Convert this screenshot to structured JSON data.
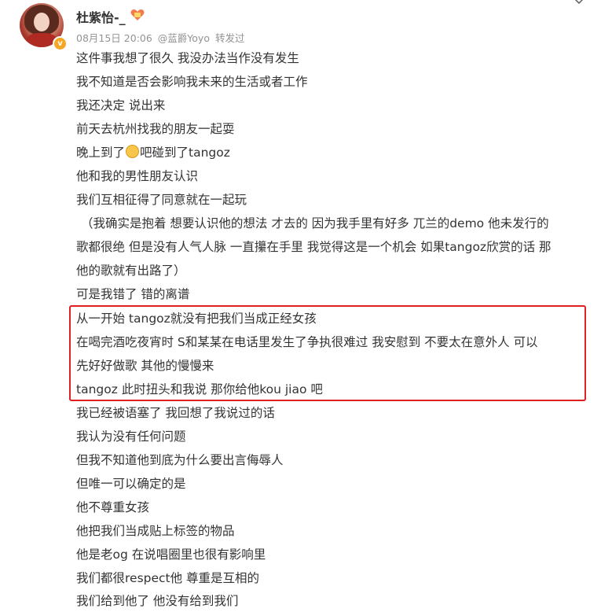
{
  "post": {
    "author": "杜紫怡-_",
    "date": "08月15日 20:06",
    "via_user": "@蓝爵Yoyo",
    "via_action": "转发过",
    "lines": [
      "这件事我想了很久 我没办法当作没有发生",
      "我不知道是否会影响我未来的生活或者工作",
      "我还决定 说出来",
      "前天去杭州找我的朋友一起耍",
      "晚上到了",
      "吧碰到了tangoz",
      "他和我的男性朋友认识",
      "我们互相征得了同意就在一起玩",
      "（我确实是抱着 想要认识他的想法 才去的 因为我手里有好多 兀兰的demo 他未发行的",
      "歌都很绝 但是没有人气人脉 一直攥在手里 我觉得这是一个机会 如果tangoz欣赏的话 那",
      "他的歌就有出路了）",
      "可是我错了 错的离谱",
      "从一开始 tangoz就没有把我们当成正经女孩",
      "在喝完酒吃夜宵时 S和某某在电话里发生了争执很难过 我安慰到 不要太在意外人 可以",
      "先好好做歌 其他的慢慢来",
      "tangoz 此时扭头和我说 那你给他kou jiao 吧",
      "我已经被语塞了 我回想了我说过的话",
      "我认为没有任何问题",
      "但我不知道他到底为什么要出言侮辱人",
      "但唯一可以确定的是",
      "他不尊重女孩",
      "他把我们当成贴上标签的物品",
      "他是老og 在说唱圈里也很有影响里",
      "我们都很respect他 尊重是互相的",
      "我们给到他了 他没有给到我们"
    ]
  },
  "icons": {
    "avatar": "avatar-image",
    "verified": "verified-badge-icon",
    "badge": "fan-badge-icon",
    "menu": "chevron-down-icon",
    "inline_emoji": "bar-emoji-icon"
  },
  "colors": {
    "highlight_border": "#e02020",
    "meta_text": "#939393",
    "body_text": "#333333"
  }
}
